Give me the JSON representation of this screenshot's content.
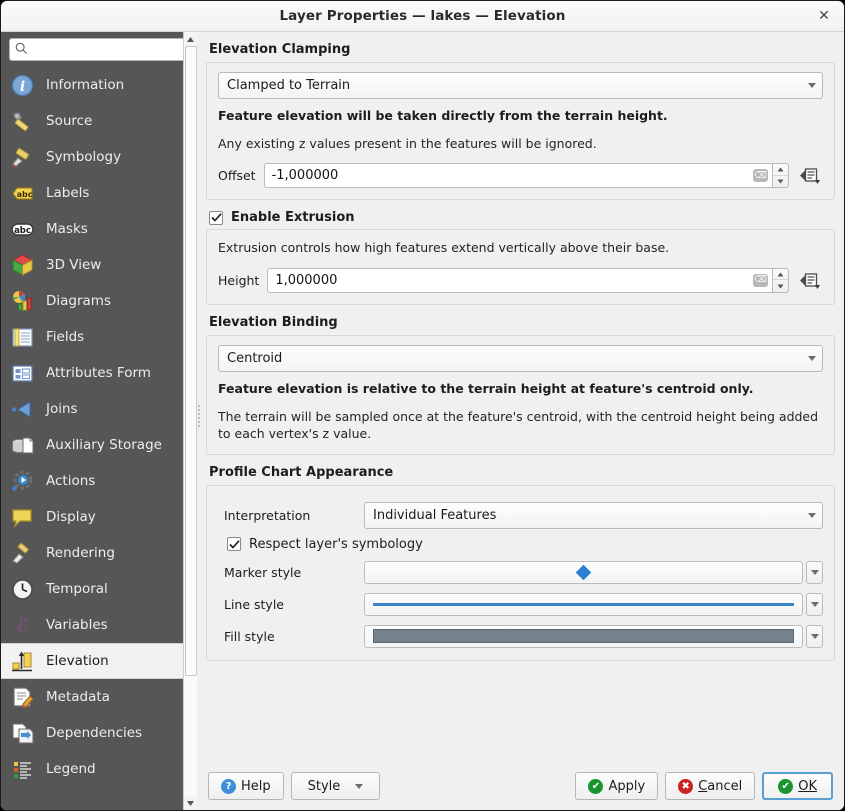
{
  "window": {
    "title": "Layer Properties — lakes — Elevation",
    "close_label": "✕"
  },
  "sidebar": {
    "search": {
      "value": "",
      "placeholder": ""
    },
    "items": [
      {
        "label": "Information",
        "icon": "information-icon",
        "selected": false
      },
      {
        "label": "Source",
        "icon": "source-icon",
        "selected": false
      },
      {
        "label": "Symbology",
        "icon": "symbology-icon",
        "selected": false
      },
      {
        "label": "Labels",
        "icon": "labels-icon",
        "selected": false
      },
      {
        "label": "Masks",
        "icon": "masks-icon",
        "selected": false
      },
      {
        "label": "3D View",
        "icon": "3d-view-icon",
        "selected": false
      },
      {
        "label": "Diagrams",
        "icon": "diagrams-icon",
        "selected": false
      },
      {
        "label": "Fields",
        "icon": "fields-icon",
        "selected": false
      },
      {
        "label": "Attributes Form",
        "icon": "attributes-form-icon",
        "selected": false
      },
      {
        "label": "Joins",
        "icon": "joins-icon",
        "selected": false
      },
      {
        "label": "Auxiliary Storage",
        "icon": "auxiliary-storage-icon",
        "selected": false
      },
      {
        "label": "Actions",
        "icon": "actions-icon",
        "selected": false
      },
      {
        "label": "Display",
        "icon": "display-icon",
        "selected": false
      },
      {
        "label": "Rendering",
        "icon": "rendering-icon",
        "selected": false
      },
      {
        "label": "Temporal",
        "icon": "temporal-icon",
        "selected": false
      },
      {
        "label": "Variables",
        "icon": "variables-icon",
        "selected": false
      },
      {
        "label": "Elevation",
        "icon": "elevation-icon",
        "selected": true
      },
      {
        "label": "Metadata",
        "icon": "metadata-icon",
        "selected": false
      },
      {
        "label": "Dependencies",
        "icon": "dependencies-icon",
        "selected": false
      },
      {
        "label": "Legend",
        "icon": "legend-icon",
        "selected": false
      }
    ]
  },
  "elevation_clamping": {
    "group_title": "Elevation Clamping",
    "mode": "Clamped to Terrain",
    "description_bold": "Feature elevation will be taken directly from the terrain height.",
    "description": "Any existing z values present in the features will be ignored.",
    "offset_label": "Offset",
    "offset_value": "-1,000000"
  },
  "extrusion": {
    "checkbox_label": "Enable Extrusion",
    "checked": true,
    "description": "Extrusion controls how high features extend vertically above their base.",
    "height_label": "Height",
    "height_value": "1,000000"
  },
  "elevation_binding": {
    "group_title": "Elevation Binding",
    "mode": "Centroid",
    "description_bold": "Feature elevation is relative to the terrain height at feature's centroid only.",
    "description": "The terrain will be sampled once at the feature's centroid, with the centroid height being added to each vertex's z value."
  },
  "profile_chart": {
    "group_title": "Profile Chart Appearance",
    "interpretation_label": "Interpretation",
    "interpretation_value": "Individual Features",
    "respect_symbology_label": "Respect layer's symbology",
    "respect_symbology_checked": true,
    "marker_style_label": "Marker style",
    "line_style_label": "Line style",
    "fill_style_label": "Fill style",
    "marker_color": "#2b7fd4",
    "line_color": "#3a86c8",
    "fill_color": "#74838b"
  },
  "footer": {
    "help": "Help",
    "style": "Style",
    "apply": "Apply",
    "cancel": "Cancel",
    "ok": "OK"
  }
}
